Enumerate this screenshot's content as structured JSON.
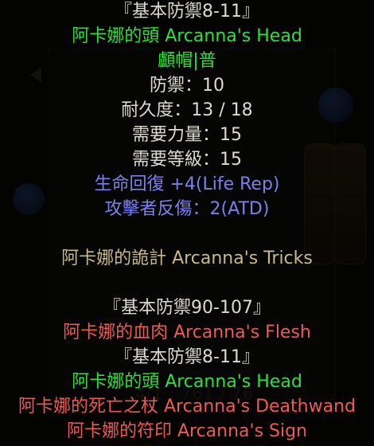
{
  "tooltip": {
    "header": "『基本防禦8-11』",
    "item_name": "阿卡娜的頭 Arcanna's Head",
    "item_type": "顱帽|普",
    "defense": "防禦：10",
    "durability": "耐久度：13 / 18",
    "req_strength": "需要力量：15",
    "req_level": "需要等級：15",
    "mod_life_rep": "生命回復 +4(Life Rep)",
    "mod_atd": "攻擊者反傷：2(ATD)",
    "set_name": "阿卡娜的詭計 Arcanna's Tricks",
    "set_items": [
      {
        "header": "『基本防禦90-107』",
        "name": "阿卡娜的血肉 Arcanna's Flesh"
      },
      {
        "header": "『基本防禦8-11』",
        "name": "阿卡娜的頭 Arcanna's Head"
      },
      {
        "name": "阿卡娜的死亡之杖 Arcanna's Deathwand"
      },
      {
        "name": "阿卡娜的符印 Arcanna's Sign"
      }
    ]
  },
  "colors": {
    "white": "#dedad2",
    "green": "#2fe03a",
    "blue": "#7c7ff0",
    "gold": "#c8bb87",
    "red": "#ef5b4f"
  }
}
